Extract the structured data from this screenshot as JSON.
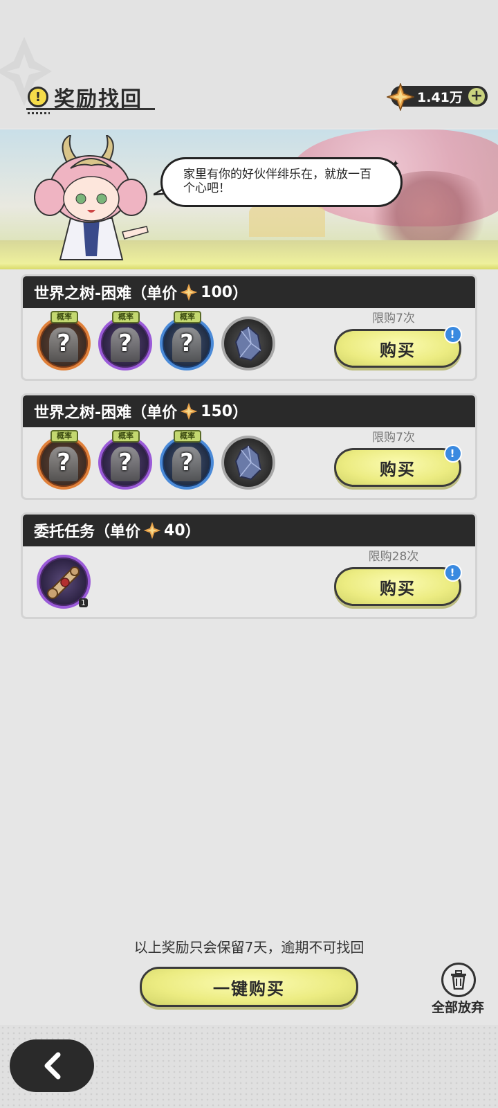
{
  "header": {
    "title": "奖励找回",
    "currency_value": "1.41万",
    "currency_icon": "gold-star-icon",
    "plus_label": "+"
  },
  "banner": {
    "speech": "家里有你的好伙伴绯乐在，就放一百个心吧！"
  },
  "cards": [
    {
      "title_prefix": "世界之树-困难（单价",
      "price": "100",
      "title_suffix": "）",
      "prob_label": "概率",
      "limit": "限购7次",
      "buy_label": "购买",
      "alert": "!"
    },
    {
      "title_prefix": "世界之树-困难（单价",
      "price": "150",
      "title_suffix": "）",
      "prob_label": "概率",
      "limit": "限购7次",
      "buy_label": "购买",
      "alert": "!"
    },
    {
      "title_prefix": "委托任务（单价",
      "price": "40",
      "title_suffix": "）",
      "item_count": "1",
      "limit": "限购28次",
      "buy_label": "购买",
      "alert": "!"
    }
  ],
  "footer": {
    "notice": "以上奖励只会保留7天，逾期不可找回",
    "buy_all_label": "一键购买",
    "abandon_label": "全部放弃"
  },
  "colors": {
    "accent": "#ecec82",
    "header_bar": "#2a2a2a",
    "alert_blue": "#3a8ae0"
  }
}
